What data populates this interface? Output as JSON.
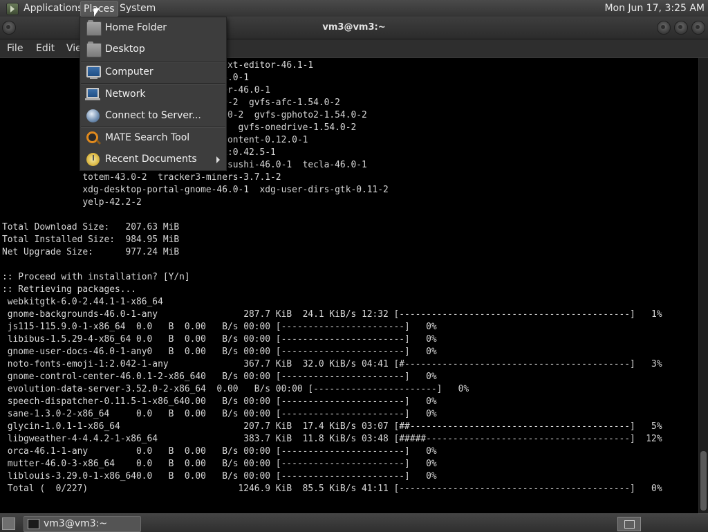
{
  "top_panel": {
    "applications": "Applications",
    "places": "Places",
    "system": "System",
    "clock": "Mon Jun 17,  3:25 AM"
  },
  "window": {
    "title": "vm3@vm3:~",
    "menu": {
      "file": "File",
      "edit": "Edit",
      "view": "Vie"
    }
  },
  "places_menu": {
    "items": [
      {
        "label": "Home Folder",
        "icon": "home-folder-icon"
      },
      {
        "label": "Desktop",
        "icon": "desktop-folder-icon"
      },
      {
        "label": "Computer",
        "icon": "computer-icon"
      },
      {
        "label": "Network",
        "icon": "network-icon"
      },
      {
        "label": "Connect to Server...",
        "icon": "globe-icon"
      },
      {
        "label": "MATE Search Tool",
        "icon": "search-icon"
      },
      {
        "label": "Recent Documents",
        "icon": "recent-documents-icon"
      }
    ]
  },
  "terminal": {
    "lines": [
      "                              -1  gnome-text-editor-46.1-1",
      "                              user-docs-46.0-1",
      "                              gnome-weather-46.0-1",
      "                               gvfs-1.54.0-2  gvfs-afc-1.54.0-2",
      "                               oogle-1.54.0-2  gvfs-gphoto2-1.54.0-2",
      "                               fs-1.54.0-2  gvfs-onedrive-1.54.0-2",
      "                              46.2-1  malcontent-0.12.0-1",
      "                              l-1  rygel-1:0.42.5-1",
      "                              hot-46.2-1  sushi-46.0-1  tecla-46.0-1",
      "               totem-43.0-2  tracker3-miners-3.7.1-2",
      "               xdg-desktop-portal-gnome-46.0-1  xdg-user-dirs-gtk-0.11-2",
      "               yelp-42.2-2",
      "",
      "Total Download Size:   207.63 MiB",
      "Total Installed Size:  984.95 MiB",
      "Net Upgrade Size:      977.24 MiB",
      "",
      ":: Proceed with installation? [Y/n]",
      ":: Retrieving packages...",
      " webkitgtk-6.0-2.44.1-1-x86_64",
      " gnome-backgrounds-46.0-1-any                287.7 KiB  24.1 KiB/s 12:32 [-------------------------------------------]   1%",
      " js115-115.9.0-1-x86_64  0.0   B  0.00   B/s 00:00 [-----------------------]   0%",
      " libibus-1.5.29-4-x86_64 0.0   B  0.00   B/s 00:00 [-----------------------]   0%",
      " gnome-user-docs-46.0-1-any0   B  0.00   B/s 00:00 [-----------------------]   0%",
      " noto-fonts-emoji-1:2.042-1-any              367.7 KiB  32.0 KiB/s 04:41 [#------------------------------------------]   3%",
      " gnome-control-center-46.0.1-2-x86_640   B/s 00:00 [-----------------------]   0%",
      " evolution-data-server-3.52.0-2-x86_64  0.00   B/s 00:00 [-----------------------]   0%",
      " speech-dispatcher-0.11.5-1-x86_640.00   B/s 00:00 [-----------------------]   0%",
      " sane-1.3.0-2-x86_64     0.0   B  0.00   B/s 00:00 [-----------------------]   0%",
      " glycin-1.0.1-1-x86_64                       207.7 KiB  17.4 KiB/s 03:07 [##-----------------------------------------]   5%",
      " libgweather-4-4.4.2-1-x86_64                383.7 KiB  11.8 KiB/s 03:48 [#####--------------------------------------]  12%",
      " orca-46.1-1-any         0.0   B  0.00   B/s 00:00 [-----------------------]   0%",
      " mutter-46.0-3-x86_64    0.0   B  0.00   B/s 00:00 [-----------------------]   0%",
      " liblouis-3.29.0-1-x86_640.0   B  0.00   B/s 00:00 [-----------------------]   0%",
      " Total (  0/227)                            1246.9 KiB  85.5 KiB/s 41:11 [-------------------------------------------]   0%"
    ]
  },
  "taskbar": {
    "task_label": "vm3@vm3:~"
  }
}
